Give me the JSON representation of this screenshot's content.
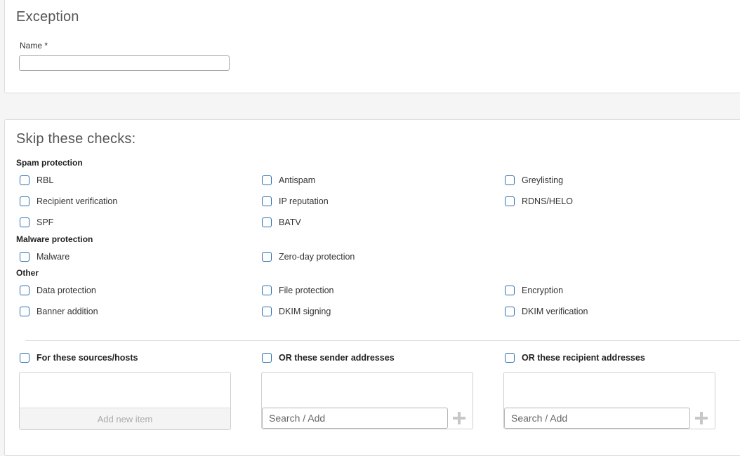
{
  "exception": {
    "title": "Exception",
    "name_label": "Name *",
    "name_value": ""
  },
  "checks": {
    "title": "Skip these checks:",
    "groups": [
      {
        "label": "Spam protection",
        "items": [
          {
            "label": "RBL",
            "checked": false
          },
          {
            "label": "Antispam",
            "checked": false
          },
          {
            "label": "Greylisting",
            "checked": false
          },
          {
            "label": "Recipient verification",
            "checked": false
          },
          {
            "label": "IP reputation",
            "checked": false
          },
          {
            "label": "RDNS/HELO",
            "checked": false
          },
          {
            "label": "SPF",
            "checked": false
          },
          {
            "label": "BATV",
            "checked": false
          }
        ]
      },
      {
        "label": "Malware protection",
        "items": [
          {
            "label": "Malware",
            "checked": false
          },
          {
            "label": "Zero-day protection",
            "checked": false
          }
        ]
      },
      {
        "label": "Other",
        "items": [
          {
            "label": "Data protection",
            "checked": false
          },
          {
            "label": "File protection",
            "checked": false
          },
          {
            "label": "Encryption",
            "checked": false
          },
          {
            "label": "Banner addition",
            "checked": false
          },
          {
            "label": "DKIM signing",
            "checked": false
          },
          {
            "label": "DKIM verification",
            "checked": false
          }
        ]
      }
    ]
  },
  "conditions": [
    {
      "label": "For these sources/hosts",
      "checked": false,
      "add_label": "Add new item"
    },
    {
      "label": "OR these sender addresses",
      "checked": false,
      "placeholder": "Search / Add"
    },
    {
      "label": "OR these recipient addresses",
      "checked": false,
      "placeholder": "Search / Add"
    }
  ],
  "icons": {
    "checkbox": "checkbox-icon",
    "plus": "plus-icon"
  },
  "colors": {
    "checkbox_border": "#2a6fb0",
    "background": "#f5f5f5",
    "panel": "#ffffff"
  }
}
